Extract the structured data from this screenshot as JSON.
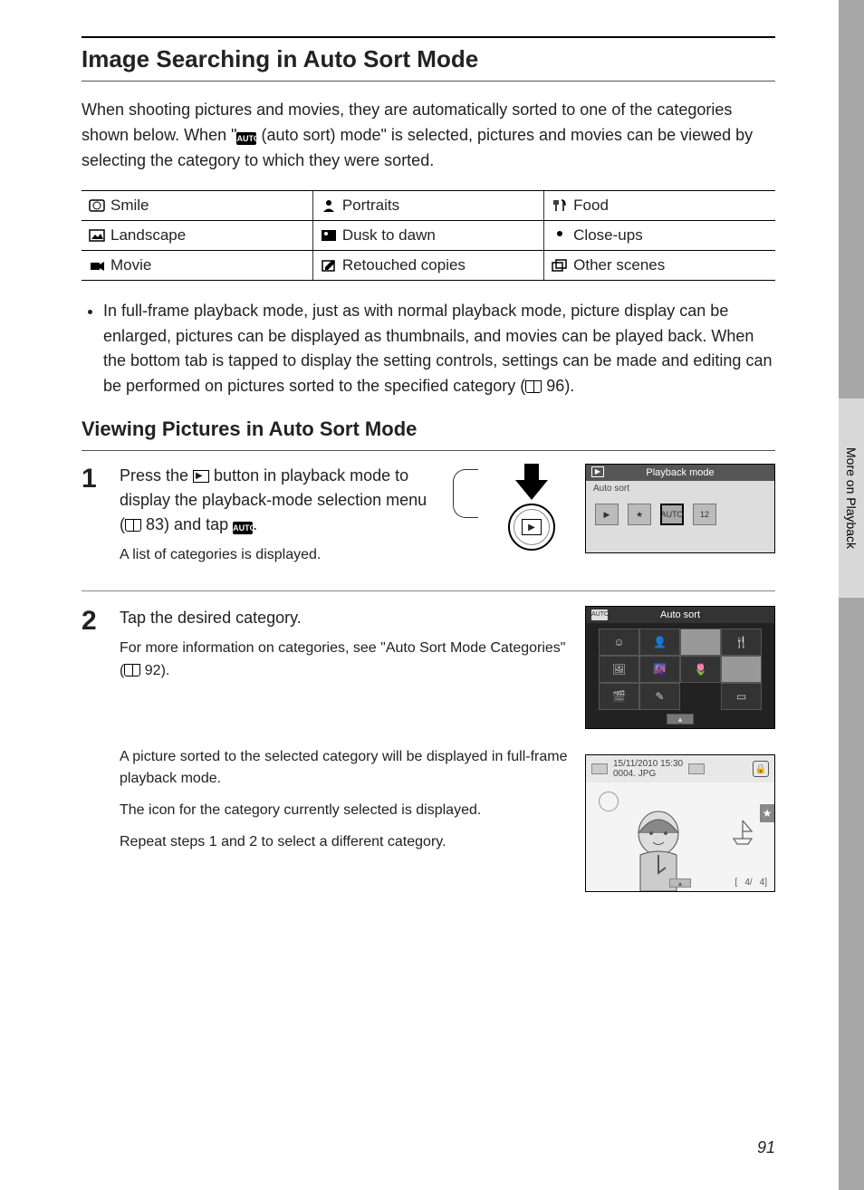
{
  "section_title": "Image Searching in Auto Sort Mode",
  "intro_before": "When shooting pictures and movies, they are automatically sorted to one of the categories shown below. When \"",
  "auto_label": "AUTO",
  "intro_after": " (auto sort) mode\" is selected, pictures and movies can be viewed by selecting the category to which they were sorted.",
  "categories": [
    [
      "Smile",
      "Portraits",
      "Food"
    ],
    [
      "Landscape",
      "Dusk to dawn",
      "Close-ups"
    ],
    [
      "Movie",
      "Retouched copies",
      "Other scenes"
    ]
  ],
  "bullet_before": "In full-frame playback mode, just as with normal playback mode, picture display can be enlarged, pictures can be displayed as thumbnails, and movies can be played back. When the bottom tab is tapped to display the setting controls, settings can be made and editing can be performed on pictures sorted to the specified category (",
  "bullet_ref": "96",
  "bullet_after": ").",
  "subsection_title": "Viewing Pictures in Auto Sort Mode",
  "step1": {
    "num": "1",
    "title_before": "Press the ",
    "title_mid": " button in playback mode to display the playback-mode selection menu (",
    "ref": "83",
    "title_after": ") and tap ",
    "title_end": ".",
    "desc": "A list of categories is displayed.",
    "screen_title": "Playback mode",
    "screen_sub": "Auto sort",
    "mode_icons": [
      "▶",
      "★",
      "AUTO",
      "12"
    ]
  },
  "step2": {
    "num": "2",
    "title": "Tap the desired category.",
    "desc_before": "For more information on categories, see \"Auto Sort Mode Categories\" (",
    "ref": "92",
    "desc_after": ").",
    "p1": "A picture sorted to the selected category will be displayed in full-frame playback mode.",
    "p2": "The icon for the category currently selected is displayed.",
    "p3": "Repeat steps 1 and 2 to select a different category.",
    "screen_title": "Auto sort",
    "grid_icons": [
      "☺",
      "👤",
      "",
      "🍴",
      "🖼",
      "🌆",
      "🌷",
      "",
      "🎬",
      "✎",
      "",
      "▭"
    ],
    "s3_date": "15/11/2010 15:30",
    "s3_file": "0004. JPG",
    "s3_counter_a": "4/",
    "s3_counter_b": "4]"
  },
  "side_tab": "More on Playback",
  "page_number": "91"
}
